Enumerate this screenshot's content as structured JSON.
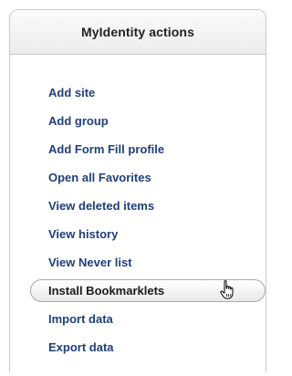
{
  "panel": {
    "title": "MyIdentity actions",
    "items": [
      {
        "label": "Add site"
      },
      {
        "label": "Add group"
      },
      {
        "label": "Add Form Fill profile"
      },
      {
        "label": "Open all Favorites"
      },
      {
        "label": "View deleted items"
      },
      {
        "label": "View history"
      },
      {
        "label": "View Never list"
      },
      {
        "label": "Install Bookmarklets"
      },
      {
        "label": "Import data"
      },
      {
        "label": "Export data"
      }
    ],
    "hovered_item": "Install Bookmarklets",
    "cursor_icon": "hand-pointer-icon",
    "colors": {
      "link": "#1f3f7a",
      "hover_text": "#1a1a1a",
      "border": "#c9c9c9"
    }
  }
}
